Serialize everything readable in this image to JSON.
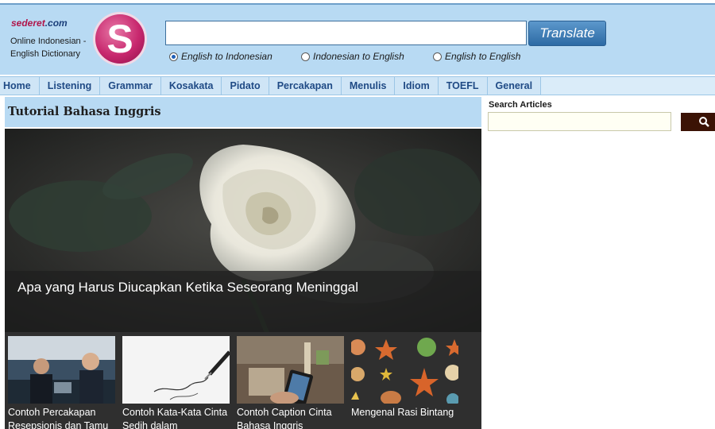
{
  "header": {
    "brand": "sederet",
    "brand_suffix": ".com",
    "tagline": "Online Indonesian - English Dictionary",
    "logo_letter": "S",
    "translate_value": "",
    "translate_button": "Translate",
    "directions": [
      {
        "label": "English to Indonesian",
        "selected": true
      },
      {
        "label": "Indonesian to English",
        "selected": false
      },
      {
        "label": "English to English",
        "selected": false
      }
    ]
  },
  "nav": {
    "items": [
      {
        "label": "Home"
      },
      {
        "label": "Listening"
      },
      {
        "label": "Grammar"
      },
      {
        "label": "Kosakata"
      },
      {
        "label": "Pidato"
      },
      {
        "label": "Percakapan"
      },
      {
        "label": "Menulis"
      },
      {
        "label": "Idiom"
      },
      {
        "label": "TOEFL"
      },
      {
        "label": "General"
      }
    ]
  },
  "main": {
    "title": "Tutorial Bahasa Inggris",
    "hero_caption": "Apa yang Harus Diucapkan Ketika Seseorang Meninggal",
    "thumbs": [
      {
        "caption": "Contoh Percakapan Resepsionis dan Tamu"
      },
      {
        "caption": "Contoh Kata-Kata Cinta Sedih dalam"
      },
      {
        "caption": "Contoh Caption Cinta Bahasa Inggris"
      },
      {
        "caption": "Mengenal Rasi Bintang"
      }
    ]
  },
  "sidebar": {
    "search_label": "Search Articles",
    "search_value": ""
  },
  "colors": {
    "header_bg": "#b8daf3",
    "nav_text": "#1f4a85",
    "brand": "#b0154a",
    "button": "#2d6aa4",
    "search_button": "#3b1305"
  }
}
